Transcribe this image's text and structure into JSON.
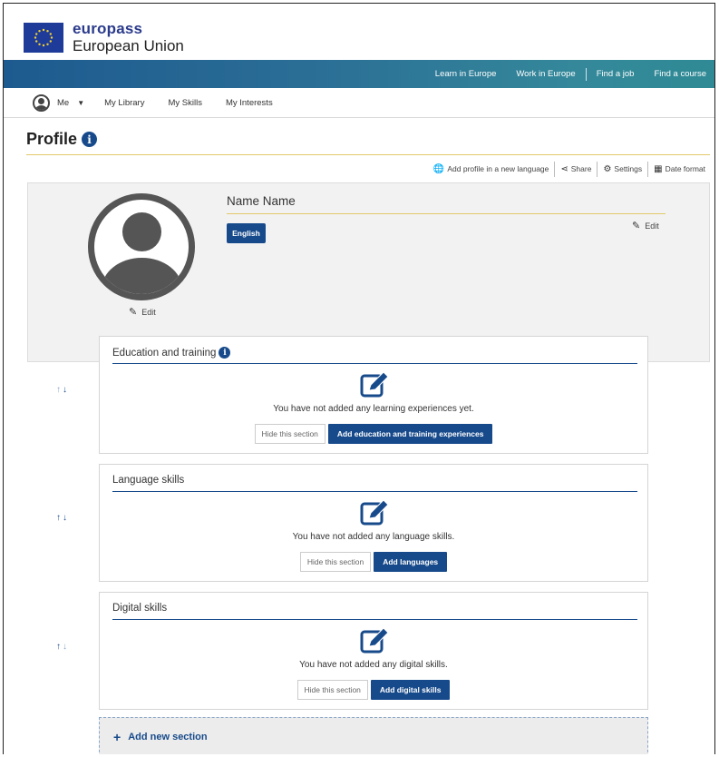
{
  "brand": {
    "name": "europass",
    "sub": "European Union"
  },
  "top_nav": [
    "Learn in Europe",
    "Work in Europe",
    "Find a job",
    "Find a course"
  ],
  "sub_nav": {
    "me": "Me",
    "links": [
      "My Library",
      "My Skills",
      "My Interests"
    ]
  },
  "page": {
    "title": "Profile"
  },
  "actions": {
    "add_language": "Add profile in a new language",
    "share": "Share",
    "settings": "Settings",
    "date_format": "Date format"
  },
  "profile": {
    "name": "Name Name",
    "language": "English",
    "edit": "Edit",
    "edit_photo": "Edit"
  },
  "sections": [
    {
      "title": "Education and training",
      "message": "You have not added any learning experiences yet.",
      "hide": "Hide this section",
      "add": "Add education and training experiences"
    },
    {
      "title": "Language skills",
      "message": "You have not added any language skills.",
      "hide": "Hide this section",
      "add": "Add languages"
    },
    {
      "title": "Digital skills",
      "message": "You have not added any digital skills.",
      "hide": "Hide this section",
      "add": "Add digital skills"
    }
  ],
  "add_new_section": "Add new section",
  "colors": {
    "primary": "#174a8b",
    "accent_rule": "#e2c86a",
    "topbar": "#2b6f96"
  },
  "icons": [
    "globe-icon",
    "share-icon",
    "gear-icon",
    "calendar-icon",
    "pencil-icon",
    "edit-note-icon",
    "info-icon",
    "arrow-up-icon",
    "arrow-down-icon",
    "plus-icon"
  ]
}
